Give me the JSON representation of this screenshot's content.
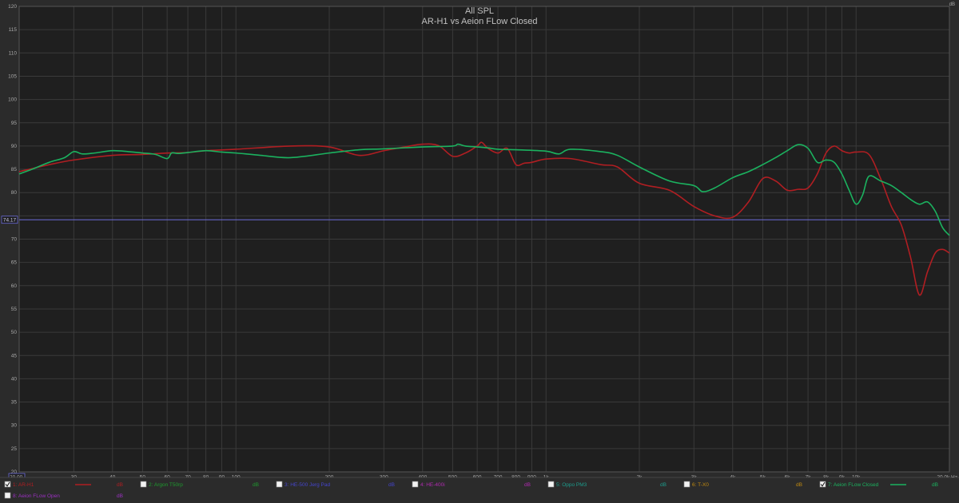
{
  "chart_data": {
    "type": "line",
    "title": "All SPL",
    "subtitle": "AR-H1 vs Aeion FLow Closed",
    "xscale": "log",
    "xlim": [
      20,
      20000
    ],
    "ylim": [
      20,
      120
    ],
    "x_unit_label": "Hz",
    "y_unit_label": "dB",
    "grid": true,
    "x_ticks": [
      {
        "v": 20,
        "label": "20.00"
      },
      {
        "v": 30,
        "label": "30"
      },
      {
        "v": 40,
        "label": "40"
      },
      {
        "v": 50,
        "label": "50"
      },
      {
        "v": 60,
        "label": "60"
      },
      {
        "v": 70,
        "label": "70"
      },
      {
        "v": 80,
        "label": "80"
      },
      {
        "v": 90,
        "label": "90"
      },
      {
        "v": 100,
        "label": "100"
      },
      {
        "v": 200,
        "label": "200"
      },
      {
        "v": 300,
        "label": "300"
      },
      {
        "v": 400,
        "label": "400"
      },
      {
        "v": 500,
        "label": "500"
      },
      {
        "v": 600,
        "label": "600"
      },
      {
        "v": 700,
        "label": "700"
      },
      {
        "v": 800,
        "label": "800"
      },
      {
        "v": 900,
        "label": "900"
      },
      {
        "v": 1000,
        "label": "1k"
      },
      {
        "v": 2000,
        "label": "2k"
      },
      {
        "v": 3000,
        "label": "3k"
      },
      {
        "v": 4000,
        "label": "4k"
      },
      {
        "v": 5000,
        "label": "5k"
      },
      {
        "v": 6000,
        "label": "6k"
      },
      {
        "v": 7000,
        "label": "7k"
      },
      {
        "v": 8000,
        "label": "8k"
      },
      {
        "v": 9000,
        "label": "9k"
      },
      {
        "v": 10000,
        "label": "10k"
      },
      {
        "v": 20000,
        "label": "20.0k Hz"
      }
    ],
    "y_ticks": [
      {
        "v": 120,
        "label": "120"
      },
      {
        "v": 115,
        "label": "115"
      },
      {
        "v": 110,
        "label": "110"
      },
      {
        "v": 105,
        "label": "105"
      },
      {
        "v": 100,
        "label": "100"
      },
      {
        "v": 95,
        "label": "95"
      },
      {
        "v": 90,
        "label": "90"
      },
      {
        "v": 85,
        "label": "85"
      },
      {
        "v": 80,
        "label": "80"
      },
      {
        "v": 75,
        "label": ""
      },
      {
        "v": 70,
        "label": "70"
      },
      {
        "v": 65,
        "label": "65"
      },
      {
        "v": 60,
        "label": "60"
      },
      {
        "v": 55,
        "label": "55"
      },
      {
        "v": 50,
        "label": "50"
      },
      {
        "v": 45,
        "label": "45"
      },
      {
        "v": 40,
        "label": "40"
      },
      {
        "v": 35,
        "label": "35"
      },
      {
        "v": 30,
        "label": "30"
      },
      {
        "v": 25,
        "label": "25"
      },
      {
        "v": 20,
        "label": "20"
      }
    ],
    "reference_line": {
      "value": 74.17,
      "label": "74.17",
      "color": "#6a6ad8"
    },
    "series": [
      {
        "name": "1: AR-H1",
        "color": "#b01e22",
        "x": [
          20,
          25,
          30,
          40,
          50,
          60,
          70,
          80,
          100,
          150,
          200,
          250,
          300,
          350,
          400,
          450,
          500,
          550,
          600,
          620,
          650,
          700,
          750,
          800,
          850,
          900,
          1000,
          1200,
          1500,
          1700,
          2000,
          2500,
          3000,
          3500,
          4000,
          4500,
          5000,
          5500,
          6000,
          6500,
          7000,
          7500,
          8000,
          8500,
          9000,
          9500,
          10000,
          11000,
          12000,
          13000,
          14000,
          15000,
          16000,
          17000,
          18000,
          19000,
          20000
        ],
        "y": [
          84.5,
          86,
          87,
          88,
          88.2,
          88.5,
          88.6,
          89,
          89.3,
          90,
          89.8,
          88,
          89,
          89.8,
          90.4,
          90.1,
          87.8,
          88.5,
          90,
          90.8,
          89.5,
          88.5,
          89.5,
          86,
          86.3,
          86.5,
          87.2,
          87.3,
          86,
          85.5,
          82,
          80.5,
          77,
          75,
          74.7,
          78,
          83,
          82.5,
          80.5,
          80.7,
          81,
          84,
          88.5,
          90,
          89,
          88.5,
          88.7,
          88.2,
          83,
          77,
          73,
          66,
          58,
          63,
          67,
          67.8,
          67
        ]
      },
      {
        "name": "7: Aeion FLow Closed",
        "color": "#1bb25f",
        "x": [
          20,
          22,
          25,
          28,
          30,
          32,
          35,
          40,
          45,
          50,
          55,
          60,
          62,
          65,
          70,
          80,
          90,
          100,
          120,
          150,
          200,
          250,
          300,
          400,
          500,
          520,
          550,
          600,
          650,
          700,
          800,
          1000,
          1100,
          1200,
          1500,
          1700,
          2000,
          2500,
          3000,
          3200,
          3500,
          4000,
          4500,
          5000,
          5500,
          6000,
          6500,
          7000,
          7500,
          8000,
          8500,
          9000,
          9500,
          10000,
          10500,
          11000,
          12000,
          13000,
          14000,
          15000,
          16000,
          17000,
          18000,
          19000,
          20000
        ],
        "y": [
          84,
          85,
          86.5,
          87.5,
          88.8,
          88.3,
          88.5,
          89,
          88.8,
          88.5,
          88.2,
          87.3,
          88.5,
          88.4,
          88.6,
          89,
          88.7,
          88.5,
          88,
          87.5,
          88.5,
          89.2,
          89.4,
          89.8,
          90,
          90.4,
          90,
          89.8,
          89.6,
          89.3,
          89.2,
          88.9,
          88.3,
          89.3,
          88.8,
          88,
          85.5,
          82.5,
          81.5,
          80.2,
          81,
          83.2,
          84.5,
          86,
          87.5,
          89,
          90.3,
          89.5,
          86.5,
          87,
          86.5,
          84,
          80.5,
          77.5,
          79.5,
          83.5,
          82.5,
          81.5,
          80,
          78.5,
          77.5,
          78,
          76,
          72.5,
          70.8
        ]
      }
    ],
    "legend": [
      {
        "id": "1",
        "label": "1: AR-H1",
        "checked": true,
        "color": "#b01e22",
        "unit": "dB",
        "show_line": true
      },
      {
        "id": "2",
        "label": "2: Argon T50rp",
        "checked": false,
        "color": "#1e9a2e",
        "unit": "dB",
        "show_line": false
      },
      {
        "id": "3",
        "label": "3: HE-500 Jerg Pad",
        "checked": false,
        "color": "#4444cc",
        "unit": "dB",
        "show_line": false
      },
      {
        "id": "4",
        "label": "4: HE-400i",
        "checked": false,
        "color": "#b02ab0",
        "unit": "dB",
        "show_line": false
      },
      {
        "id": "5",
        "label": "5: Oppo PM3",
        "checked": false,
        "color": "#1c9c8c",
        "unit": "dB",
        "show_line": false
      },
      {
        "id": "6",
        "label": "6: T-X0",
        "checked": false,
        "color": "#c08a10",
        "unit": "dB",
        "show_line": false
      },
      {
        "id": "7",
        "label": "7: Aeion FLow Closed",
        "checked": true,
        "color": "#1bb25f",
        "unit": "dB",
        "show_line": true
      },
      {
        "id": "8",
        "label": "8: Aeion FLow Open",
        "checked": false,
        "color": "#9a30c0",
        "unit": "dB",
        "show_line": false
      }
    ]
  }
}
